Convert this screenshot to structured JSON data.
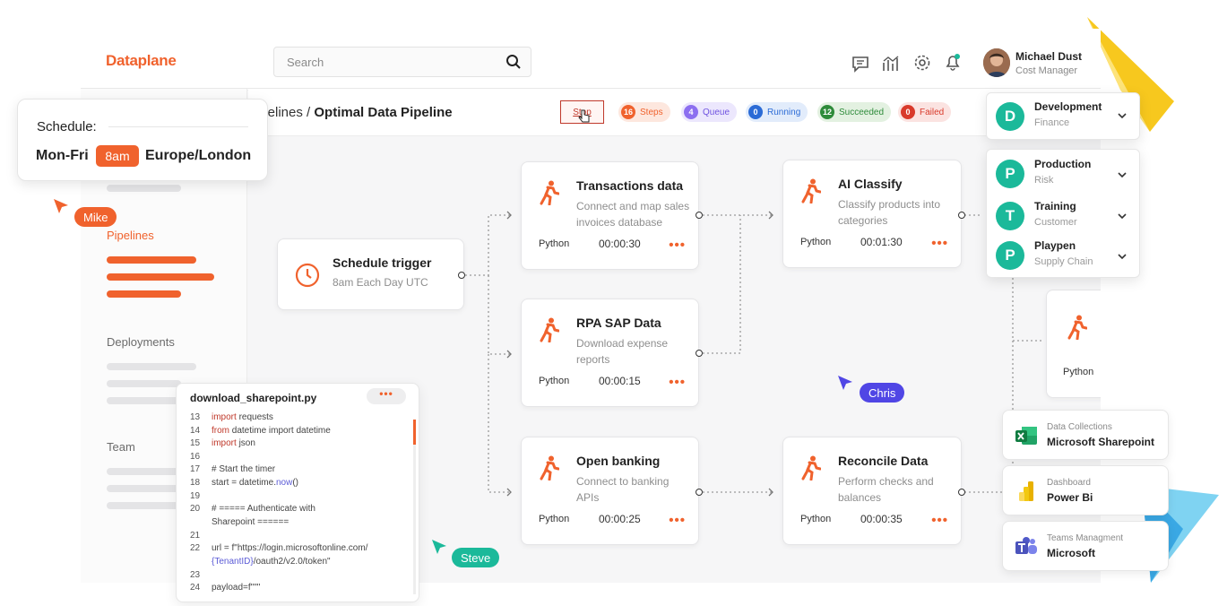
{
  "app": {
    "logo": "Dataplane"
  },
  "search": {
    "placeholder": "Search"
  },
  "user": {
    "name": "Michael Dust",
    "role": "Cost Manager"
  },
  "breadcrumb": {
    "prefix": "ipelines / ",
    "current": "Optimal Data Pipeline"
  },
  "status": {
    "stop_label": "Stop",
    "steps": {
      "count": "16",
      "label": "Steps",
      "color": "#f0622d"
    },
    "queue": {
      "count": "4",
      "label": "Queue",
      "color": "#8c6ff0"
    },
    "running": {
      "count": "0",
      "label": "Running",
      "color": "#2b6bd6"
    },
    "succeeded": {
      "count": "12",
      "label": "Succeeded",
      "color": "#2e8b3a"
    },
    "failed": {
      "count": "0",
      "label": "Failed",
      "color": "#d93a2b"
    }
  },
  "sidebar": {
    "pipelines": "Pipelines",
    "deployments": "Deployments",
    "team": "Team"
  },
  "schedule_popup": {
    "title": "Schedule:",
    "days": "Mon-Fri",
    "time": "8am",
    "zone": "Europe/London"
  },
  "trigger": {
    "title": "Schedule trigger",
    "desc": "8am Each Day UTC"
  },
  "nodes": {
    "transactions": {
      "title": "Transactions data",
      "desc": "Connect and map sales invoices database",
      "lang": "Python",
      "time": "00:00:30",
      "dots": "•••"
    },
    "rpa": {
      "title": "RPA SAP Data",
      "desc": "Download expense reports",
      "lang": "Python",
      "time": "00:00:15",
      "dots": "•••"
    },
    "banking": {
      "title": "Open banking",
      "desc": "Connect to banking APIs",
      "lang": "Python",
      "time": "00:00:25",
      "dots": "•••"
    },
    "classify": {
      "title": "AI Classify",
      "desc": "Classify products into categories",
      "lang": "Python",
      "time": "00:01:30",
      "dots": "•••"
    },
    "reconcile": {
      "title": "Reconcile Data",
      "desc": "Perform checks and balances",
      "lang": "Python",
      "time": "00:00:35",
      "dots": "•••"
    },
    "partial": {
      "lang": "Python"
    }
  },
  "environments": [
    {
      "initial": "D",
      "name": "Development",
      "sub": "Finance"
    },
    {
      "initial": "P",
      "name": "Production",
      "sub": "Risk"
    },
    {
      "initial": "T",
      "name": "Training",
      "sub": "Customer"
    },
    {
      "initial": "P",
      "name": "Playpen",
      "sub": "Supply Chain"
    }
  ],
  "integrations": [
    {
      "sub": "Data Collections",
      "name": "Microsoft Sharepoint",
      "icon": "excel-icon"
    },
    {
      "sub": "Dashboard",
      "name": "Power Bi",
      "icon": "powerbi-icon"
    },
    {
      "sub": "Teams Managment",
      "name": "Microsoft",
      "icon": "teams-icon"
    }
  ],
  "code_editor": {
    "filename": "download_sharepoint.py",
    "dots": "•••",
    "lines": [
      {
        "n": "13",
        "kw": "import",
        "rest": " requests"
      },
      {
        "n": "14",
        "kw": "from",
        "rest": " datetime import datetime"
      },
      {
        "n": "15",
        "kw": "import",
        "rest": " json"
      },
      {
        "n": "16",
        "kw": "",
        "rest": ""
      },
      {
        "n": "17",
        "kw": "",
        "rest": "# Start the timer"
      },
      {
        "n": "18",
        "kw": "",
        "rest": "start  = datetime.",
        "fn": "now",
        "tail": "()"
      },
      {
        "n": "19",
        "kw": "",
        "rest": ""
      },
      {
        "n": "20",
        "kw": "",
        "rest": "# ===== Authenticate with"
      },
      {
        "n": "",
        "kw": "",
        "rest": "Sharepoint ======"
      },
      {
        "n": "21",
        "kw": "",
        "rest": ""
      },
      {
        "n": "22",
        "kw": "",
        "rest": "url = f\"https://login.microsoftonline.com/"
      },
      {
        "n": "",
        "kw": "",
        "rest": "",
        "fn": "{TenantID}",
        "tail": "/oauth2/v2.0/token\""
      },
      {
        "n": "23",
        "kw": "",
        "rest": ""
      },
      {
        "n": "24",
        "kw": "",
        "rest": "payload=f\"\"\""
      }
    ]
  },
  "cursors": {
    "mike": {
      "name": "Mike",
      "color": "#f0622d"
    },
    "chris": {
      "name": "Chris",
      "color": "#5046e5"
    },
    "steve": {
      "name": "Steve",
      "color": "#1bb99a"
    }
  }
}
